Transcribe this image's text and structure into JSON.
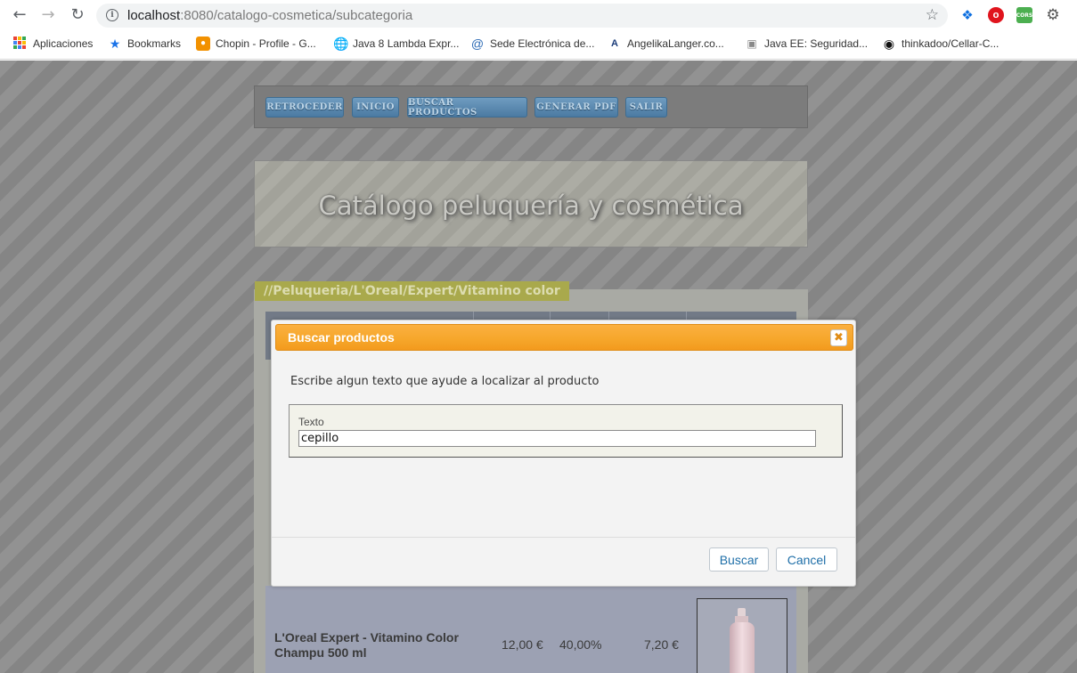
{
  "browser": {
    "url_host": "localhost",
    "url_rest": ":8080/catalogo-cosmetica/subcategoria",
    "icons": {
      "back": "arrow-left-icon",
      "forward": "arrow-right-icon",
      "reload": "reload-icon",
      "info": "info-icon",
      "star": "star-icon"
    },
    "extensions": [
      "dropbox-icon",
      "opera-icon",
      "cors-icon",
      "gear-icon"
    ],
    "extension_cors_label": "CORS",
    "bookmarks": [
      {
        "label": "Aplicaciones",
        "icon": "apps-grid-icon"
      },
      {
        "label": "Bookmarks",
        "icon": "star-icon"
      },
      {
        "label": "Chopin - Profile - G...",
        "icon": "orange-logo-icon"
      },
      {
        "label": "Java 8 Lambda Expr...",
        "icon": "globe-icon"
      },
      {
        "label": "Sede Electrónica de...",
        "icon": "at-icon"
      },
      {
        "label": "AngelikaLanger.co...",
        "icon": "al-logo-icon"
      },
      {
        "label": "Java EE: Seguridad...",
        "icon": "camera-icon"
      },
      {
        "label": "thinkadoo/Cellar-C...",
        "icon": "github-icon"
      }
    ]
  },
  "app": {
    "nav": {
      "back": "RETROCEDER",
      "home": "INICIO",
      "search": "BUSCAR PRODUCTOS",
      "pdf": "GENERAR PDF",
      "exit": "SALIR"
    },
    "title": "Catálogo peluquería y cosmética",
    "breadcrumb": "//Peluqueria/L'Oreal/Expert/Vitamino color",
    "product": {
      "name": "L'Oreal Expert - Vitamino Color Champu 500 ml",
      "price": "12,00 €",
      "discount": "40,00%",
      "final_price": "7,20 €"
    }
  },
  "dialog": {
    "title": "Buscar productos",
    "message": "Escribe algun texto que ayude a localizar al producto",
    "field_label": "Texto",
    "field_value": "cepillo",
    "search_button": "Buscar",
    "cancel_button": "Cancel",
    "close_icon": "close-icon"
  },
  "colors": {
    "dialog_header": "#f6a72c",
    "nav_button": "#5a89b1",
    "breadcrumb_bg": "#a9a94c",
    "button_text": "#1f6fa8"
  }
}
